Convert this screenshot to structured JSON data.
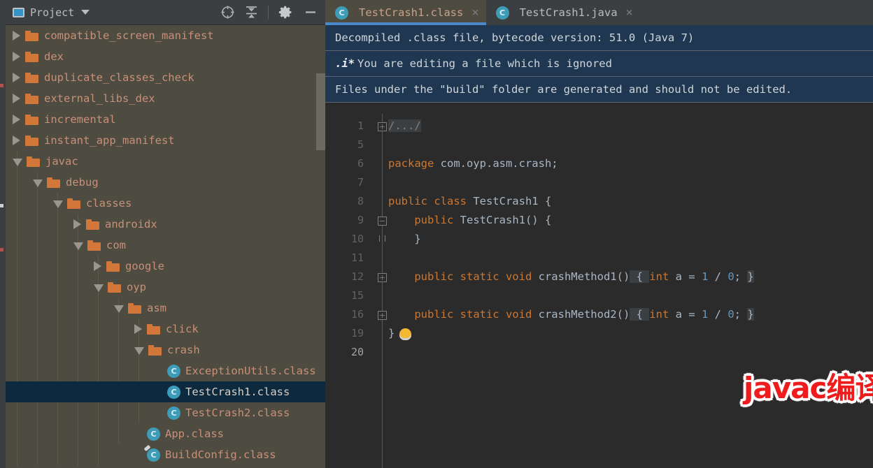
{
  "panel": {
    "title": "Project",
    "window_icon": "window-icon",
    "dropdown_icon": "chevron-down-icon",
    "toolbar_icons": [
      {
        "name": "locate-target-icon",
        "glyph": "locate"
      },
      {
        "name": "collapse-all-icon",
        "glyph": "collapse"
      },
      {
        "name": "settings-gear-icon",
        "glyph": "gear"
      },
      {
        "name": "hide-panel-icon",
        "glyph": "minus"
      }
    ]
  },
  "tree": {
    "items": [
      {
        "label": "compatible_screen_manifest",
        "indent": 0,
        "state": "collapsed",
        "kind": "folder",
        "selected": false
      },
      {
        "label": "dex",
        "indent": 0,
        "state": "collapsed",
        "kind": "folder",
        "selected": false
      },
      {
        "label": "duplicate_classes_check",
        "indent": 0,
        "state": "collapsed",
        "kind": "folder",
        "selected": false
      },
      {
        "label": "external_libs_dex",
        "indent": 0,
        "state": "collapsed",
        "kind": "folder",
        "selected": false
      },
      {
        "label": "incremental",
        "indent": 0,
        "state": "collapsed",
        "kind": "folder",
        "selected": false
      },
      {
        "label": "instant_app_manifest",
        "indent": 0,
        "state": "collapsed",
        "kind": "folder",
        "selected": false
      },
      {
        "label": "javac",
        "indent": 0,
        "state": "expanded",
        "kind": "folder",
        "selected": false
      },
      {
        "label": "debug",
        "indent": 1,
        "state": "expanded",
        "kind": "folder",
        "selected": false
      },
      {
        "label": "classes",
        "indent": 2,
        "state": "expanded",
        "kind": "folder",
        "selected": false
      },
      {
        "label": "androidx",
        "indent": 3,
        "state": "collapsed",
        "kind": "folder",
        "selected": false
      },
      {
        "label": "com",
        "indent": 3,
        "state": "expanded",
        "kind": "folder",
        "selected": false
      },
      {
        "label": "google",
        "indent": 4,
        "state": "collapsed",
        "kind": "folder",
        "selected": false
      },
      {
        "label": "oyp",
        "indent": 4,
        "state": "expanded",
        "kind": "folder",
        "selected": false
      },
      {
        "label": "asm",
        "indent": 5,
        "state": "expanded",
        "kind": "folder",
        "selected": false
      },
      {
        "label": "click",
        "indent": 6,
        "state": "collapsed",
        "kind": "folder",
        "selected": false
      },
      {
        "label": "crash",
        "indent": 6,
        "state": "expanded",
        "kind": "folder",
        "selected": false
      },
      {
        "label": "ExceptionUtils.class",
        "indent": 7,
        "state": "leaf",
        "kind": "class",
        "selected": false
      },
      {
        "label": "TestCrash1.class",
        "indent": 7,
        "state": "leaf",
        "kind": "class",
        "selected": true
      },
      {
        "label": "TestCrash2.class",
        "indent": 7,
        "state": "leaf",
        "kind": "class",
        "selected": false
      },
      {
        "label": "App.class",
        "indent": 6,
        "state": "leaf",
        "kind": "class",
        "selected": false
      },
      {
        "label": "BuildConfig.class",
        "indent": 6,
        "state": "class-generated",
        "kind": "class",
        "selected": false
      }
    ]
  },
  "editor": {
    "tabs": [
      {
        "label": "TestCrash1.class",
        "icon": "java-class-icon",
        "active": true,
        "close": "×"
      },
      {
        "label": "TestCrash1.java",
        "icon": "java-class-icon",
        "active": false,
        "close": "×"
      }
    ],
    "banners": [
      {
        "text": "Decompiled .class file, bytecode version: 51.0 (Java 7)",
        "icon": ""
      },
      {
        "text": "You are editing a file which is ignored",
        "icon": ".i*"
      },
      {
        "text": "Files under the \"build\" folder are generated and should not be edited.",
        "icon": ""
      }
    ],
    "line_numbers": [
      "1",
      "5",
      "6",
      "7",
      "8",
      "9",
      "10",
      "11",
      "12",
      "15",
      "16",
      "19",
      "20"
    ],
    "current_line": "20",
    "code_lines": [
      {
        "n": "1",
        "fold": "plus",
        "segments": [
          {
            "t": "/.../",
            "c": "fold-doc"
          }
        ]
      },
      {
        "n": "5",
        "fold": "",
        "segments": []
      },
      {
        "n": "6",
        "fold": "",
        "segments": [
          {
            "t": "package",
            "c": "kw"
          },
          {
            "t": " com.oyp.asm.crash;",
            "c": "txt"
          }
        ]
      },
      {
        "n": "7",
        "fold": "",
        "segments": []
      },
      {
        "n": "8",
        "fold": "",
        "segments": [
          {
            "t": "public class",
            "c": "kw"
          },
          {
            "t": " TestCrash1 {",
            "c": "txt"
          }
        ]
      },
      {
        "n": "9",
        "fold": "brace-top",
        "segments": [
          {
            "t": "    ",
            "c": "dot"
          },
          {
            "t": "public",
            "c": "kw"
          },
          {
            "t": " TestCrash1() {",
            "c": "txt"
          }
        ]
      },
      {
        "n": "10",
        "fold": "brace-bottom",
        "segments": [
          {
            "t": "    ",
            "c": "dot"
          },
          {
            "t": "}",
            "c": "txt"
          }
        ]
      },
      {
        "n": "11",
        "fold": "",
        "segments": []
      },
      {
        "n": "12",
        "fold": "plus",
        "segments": [
          {
            "t": "    ",
            "c": "dot"
          },
          {
            "t": "public static void",
            "c": "kw"
          },
          {
            "t": " crashMethod1()",
            "c": "txt"
          },
          {
            "t": " { ",
            "c": "fold-collapsed"
          },
          {
            "t": "int",
            "c": "kw"
          },
          {
            "t": " a = ",
            "c": "txt"
          },
          {
            "t": "1",
            "c": "num"
          },
          {
            "t": " / ",
            "c": "txt"
          },
          {
            "t": "0",
            "c": "num"
          },
          {
            "t": "; ",
            "c": "txt"
          },
          {
            "t": "}",
            "c": "fold-collapsed"
          }
        ]
      },
      {
        "n": "15",
        "fold": "",
        "segments": []
      },
      {
        "n": "16",
        "fold": "plus",
        "segments": [
          {
            "t": "    ",
            "c": "dot"
          },
          {
            "t": "public static void",
            "c": "kw"
          },
          {
            "t": " crashMethod2()",
            "c": "txt"
          },
          {
            "t": " { ",
            "c": "fold-collapsed"
          },
          {
            "t": "int",
            "c": "kw"
          },
          {
            "t": " a = ",
            "c": "txt"
          },
          {
            "t": "1",
            "c": "num"
          },
          {
            "t": " / ",
            "c": "txt"
          },
          {
            "t": "0",
            "c": "num"
          },
          {
            "t": "; ",
            "c": "txt"
          },
          {
            "t": "}",
            "c": "fold-collapsed"
          }
        ]
      },
      {
        "n": "19",
        "fold": "",
        "segments": [
          {
            "t": "}",
            "c": "txt"
          }
        ],
        "bulb": true
      },
      {
        "n": "20",
        "fold": "",
        "segments": []
      }
    ]
  },
  "annotation": {
    "text": "javac编译后的字节码",
    "color": "#ee1c1c",
    "outline": "#ffffff"
  },
  "colors": {
    "panel_bg": "#4e4b41",
    "editor_bg": "#2b2b2b",
    "chrome_bg": "#3c3f41",
    "selection": "#0d293e",
    "banner_bg": "#1f3750",
    "tab_accent": "#4a88c7",
    "folder": "#d2763a",
    "class_icon": "#3d9cb8",
    "keyword": "#cc7832",
    "number": "#6897bb",
    "identifier": "#a9b7c6"
  }
}
